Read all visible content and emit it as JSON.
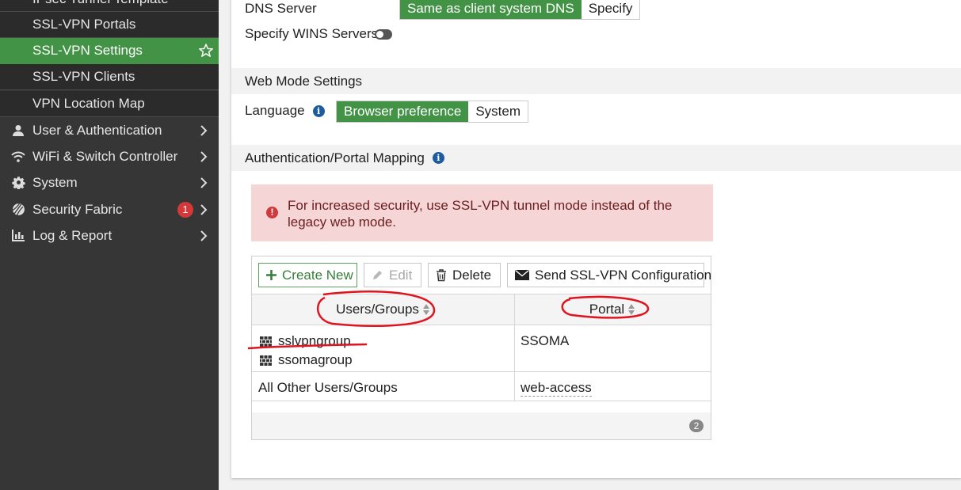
{
  "sidebar": {
    "sub_items": [
      {
        "label": "IPsec Tunnel Template"
      },
      {
        "label": "SSL-VPN Portals"
      },
      {
        "label": "SSL-VPN Settings"
      },
      {
        "label": "SSL-VPN Clients"
      },
      {
        "label": "VPN Location Map"
      }
    ],
    "top_items": [
      {
        "label": "User & Authentication",
        "icon": "user-icon"
      },
      {
        "label": "WiFi & Switch Controller",
        "icon": "wifi-icon"
      },
      {
        "label": "System",
        "icon": "gear-icon"
      },
      {
        "label": "Security Fabric",
        "icon": "fabric-icon",
        "badge": "1"
      },
      {
        "label": "Log & Report",
        "icon": "chart-icon"
      }
    ]
  },
  "dns": {
    "label": "DNS Server",
    "options": [
      "Same as client system DNS",
      "Specify"
    ],
    "selected": "Same as client system DNS"
  },
  "wins": {
    "label": "Specify WINS Servers",
    "enabled": false
  },
  "web_mode": {
    "section_title": "Web Mode Settings",
    "language_label": "Language",
    "options": [
      "Browser preference",
      "System"
    ],
    "selected": "Browser preference"
  },
  "auth_mapping": {
    "section_title": "Authentication/Portal Mapping",
    "warning": "For increased security, use SSL-VPN tunnel mode instead of the legacy web mode.",
    "toolbar": {
      "create": "Create New",
      "edit": "Edit",
      "delete": "Delete",
      "send": "Send SSL-VPN Configuration"
    },
    "columns": [
      "Users/Groups",
      "Portal"
    ],
    "rows": [
      {
        "groups": [
          "sslvpngroup",
          "ssomagroup"
        ],
        "portal": "SSOMA"
      },
      {
        "groups": [
          "All Other Users/Groups"
        ],
        "portal": "web-access"
      }
    ],
    "count": "2"
  },
  "colors": {
    "accent": "#439346",
    "sidebar_bg": "#363636",
    "warning_bg": "#f6d5d6",
    "annotation": "#e0141e"
  }
}
